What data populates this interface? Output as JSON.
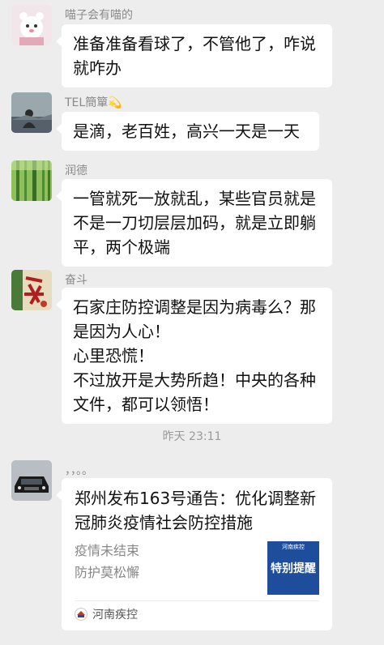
{
  "messages": [
    {
      "sender": "喵子会有喵的",
      "lines": [
        "准备准备看球了，不管他了，咋说",
        "就咋办"
      ],
      "avatar_icon": "cartoon-cat-avatar-icon"
    },
    {
      "sender": "TEL簡簞💫",
      "lines": [
        "是滴，老百姓，高兴一天是一天"
      ],
      "avatar_icon": "person-landscape-avatar-icon"
    },
    {
      "sender": "润德",
      "lines": [
        "一管就死一放就乱，某些官员就是",
        "不是一刀切层层加码，就是立即躺",
        "平，两个极端"
      ],
      "avatar_icon": "bamboo-forest-avatar-icon"
    },
    {
      "sender": "奋斗",
      "lines": [
        "石家庄防控调整是因为病毒么？那",
        "是因为人心！",
        "心里恐慌！",
        "不过放开是大势所趋！中央的各种",
        "文件，都可以领悟！"
      ],
      "avatar_icon": "calligraphy-avatar-icon"
    }
  ],
  "timestamp": "昨天 23:11",
  "card_message": {
    "sender": "，，。。",
    "avatar_icon": "black-car-avatar-icon",
    "title_lines": [
      "郑州发布163号通告：优化调整新",
      "冠肺炎疫情社会防控措施"
    ],
    "desc_lines": [
      "疫情未结束",
      "防护莫松懈"
    ],
    "thumb_header": "河南疾控",
    "thumb_text": "特别提醒",
    "source": "河南疾控",
    "source_icon": "henan-cdc-logo-icon"
  }
}
